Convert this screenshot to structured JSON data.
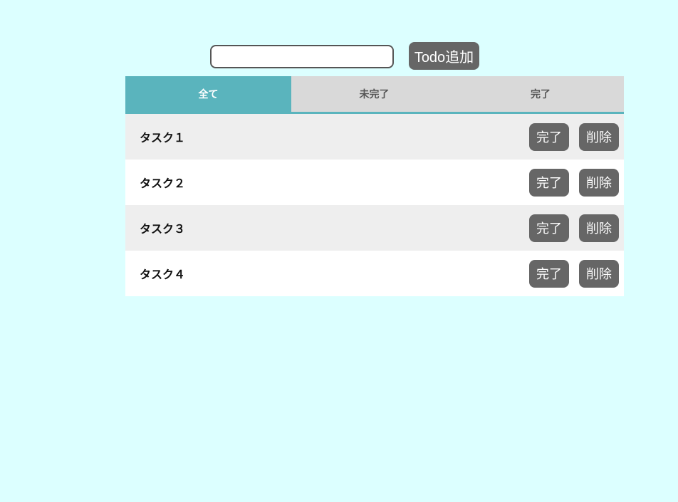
{
  "add_form": {
    "input_value": "",
    "input_placeholder": "",
    "add_button_label": "Todo追加"
  },
  "tabs": [
    {
      "label": "全て",
      "active": true
    },
    {
      "label": "未完了",
      "active": false
    },
    {
      "label": "完了",
      "active": false
    }
  ],
  "tasks": [
    {
      "label": "タスク１",
      "complete_label": "完了",
      "delete_label": "削除"
    },
    {
      "label": "タスク２",
      "complete_label": "完了",
      "delete_label": "削除"
    },
    {
      "label": "タスク３",
      "complete_label": "完了",
      "delete_label": "削除"
    },
    {
      "label": "タスク４",
      "complete_label": "完了",
      "delete_label": "削除"
    }
  ],
  "colors": {
    "background": "#dcffff",
    "accent": "#5ab4bd",
    "button": "#666666",
    "tab_inactive": "#d9d9d9",
    "row_odd": "#eeeeee",
    "row_even": "#ffffff"
  }
}
